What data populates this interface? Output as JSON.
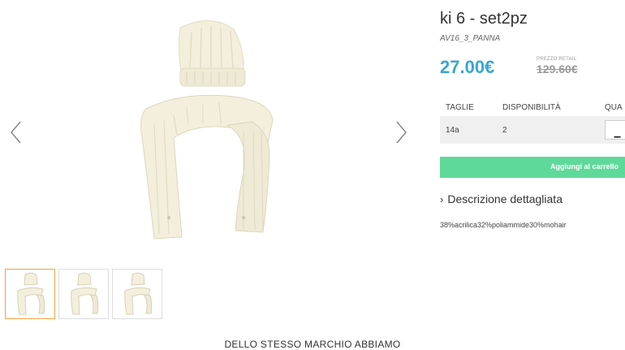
{
  "product": {
    "title": "ki 6 - set2pz",
    "sku": "AV16_3_PANNA",
    "price": "27.00€",
    "retail_label": "PREZZO RETAIL",
    "retail_price": "129.60€"
  },
  "table": {
    "headers": [
      "TAGLIE",
      "DISPONIBILITÀ",
      "QUA"
    ],
    "rows": [
      {
        "size": "14a",
        "availability": "2"
      }
    ],
    "qty_minus": "−"
  },
  "cart_button": "Aggiungi al carrello",
  "description": {
    "toggle": "Descrizione dettagliata",
    "chevron": "›",
    "text": "38%acrilica32%poliammide30%mohair"
  },
  "related_heading": "DELLO STESSO MARCHIO ABBIAMO",
  "colors": {
    "price": "#3aa5d6",
    "cart": "#5fd99a",
    "thumb_active": "#f0a341"
  },
  "icons": [
    "chevron-left-icon",
    "chevron-right-icon",
    "chevron-right-small-icon",
    "minus-icon"
  ]
}
